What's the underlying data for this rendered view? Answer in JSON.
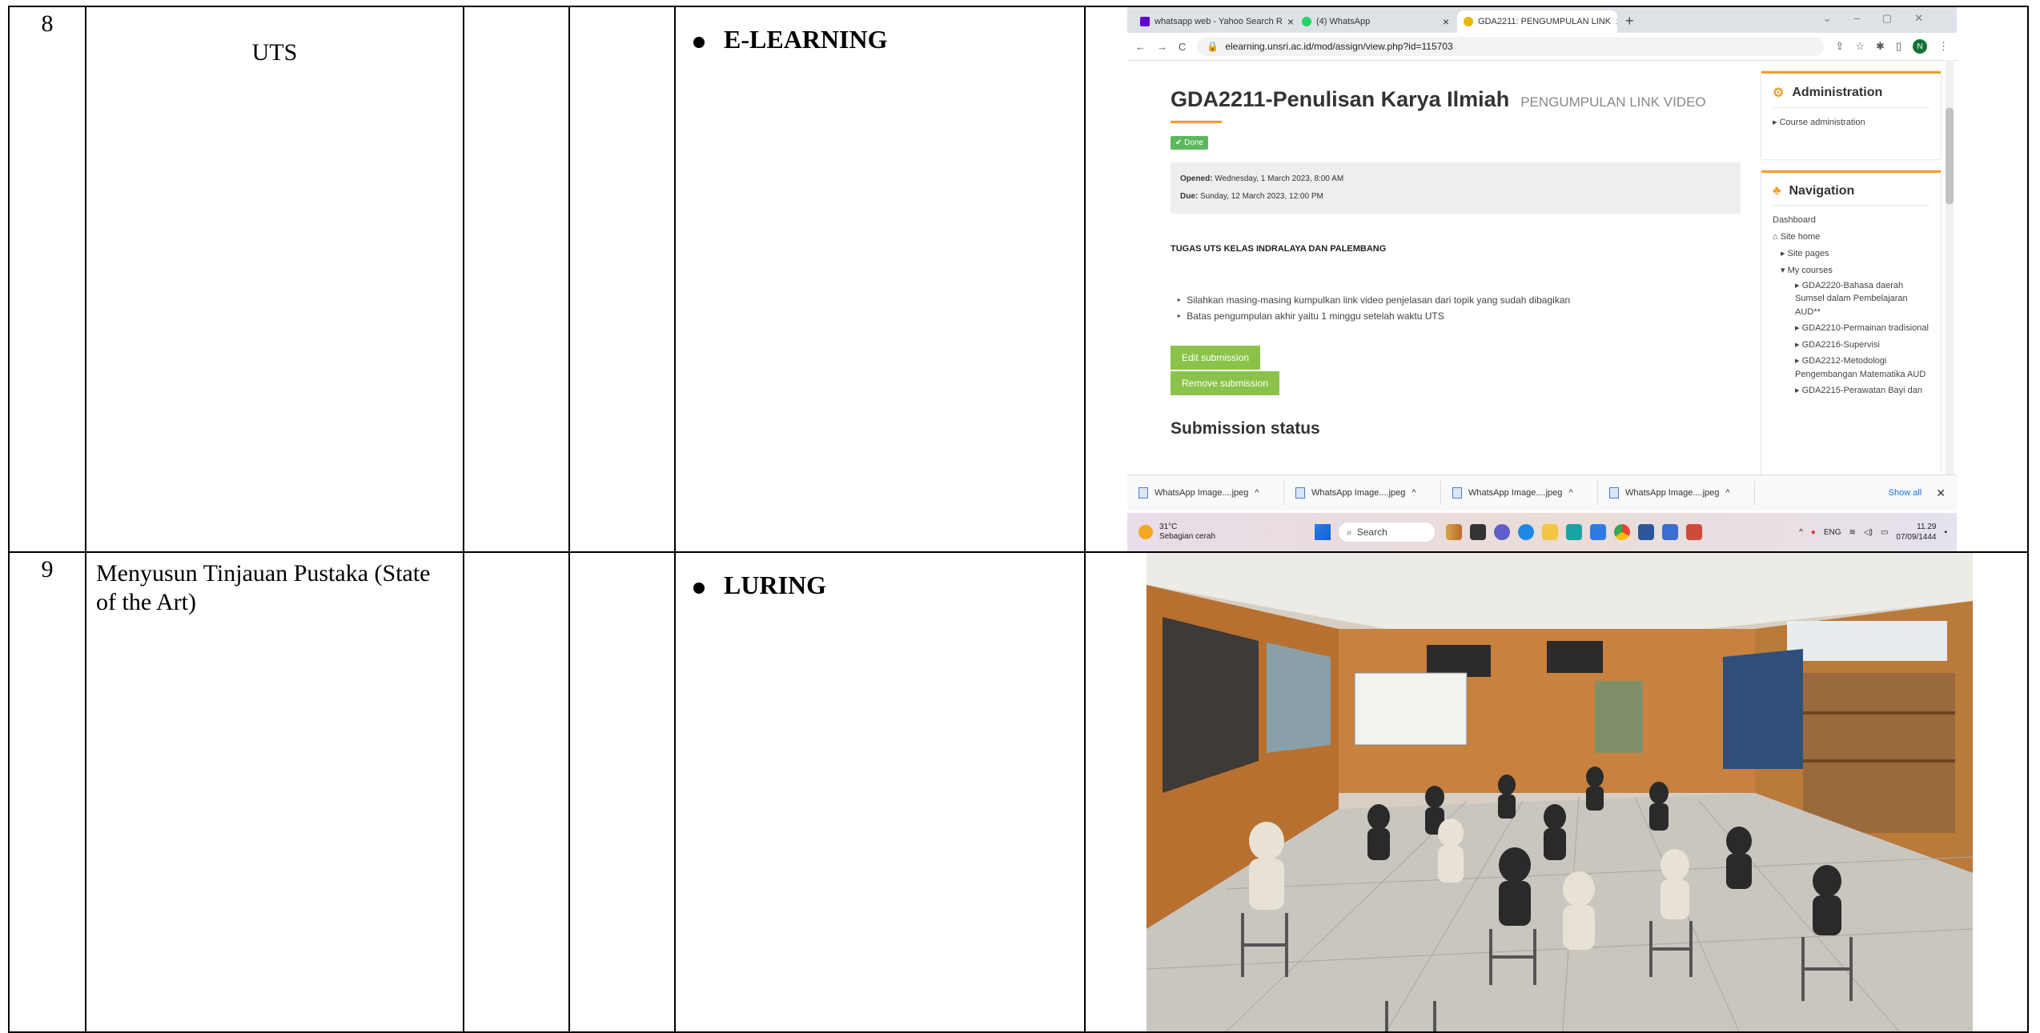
{
  "rows": [
    {
      "number": "8",
      "topic": "UTS",
      "method": "E-LEARNING",
      "evidence": {
        "browser": {
          "tabs": [
            {
              "label": "whatsapp web - Yahoo Search R",
              "color": "#6001d2"
            },
            {
              "label": "(4) WhatsApp",
              "color": "#25d366"
            },
            {
              "label": "GDA2211: PENGUMPULAN LINK",
              "color": "#e6b800"
            }
          ],
          "url": "elearning.unsri.ac.id/mod/assign/view.php?id=115703",
          "avatar_letter": "N"
        },
        "course": {
          "title": "GDA2211-Penulisan Karya Ilmiah",
          "subtitle": "PENGUMPULAN LINK VIDEO",
          "done_badge": "✔ Done",
          "opened_label": "Opened:",
          "opened_value": "Wednesday, 1 March 2023, 8:00 AM",
          "due_label": "Due:",
          "due_value": "Sunday, 12 March 2023, 12:00 PM",
          "task_heading": "TUGAS UTS KELAS INDRALAYA DAN PALEMBANG",
          "items": [
            "Silahkan masing-masing kumpulkan link video penjelasan dari topik yang sudah dibagikan",
            "Batas pengumpulan akhir yaitu 1 minggu setelah waktu UTS"
          ],
          "edit_button": "Edit submission",
          "remove_button": "Remove submission",
          "submission_heading": "Submission status"
        },
        "sidebar": {
          "admin_title": "Administration",
          "admin_item": "Course administration",
          "nav_title": "Navigation",
          "nav_dashboard": "Dashboard",
          "nav_site_home": "Site home",
          "nav_site_pages": "Site pages",
          "nav_my_courses": "My courses",
          "courses": [
            "GDA2220-Bahasa daerah Sumsel dalam Pembelajaran AUD**",
            "GDA2210-Permainan tradisional",
            "GDA2216-Supervisi",
            "GDA2212-Metodologi Pengembangan Matematika AUD",
            "GDA2215-Perawatan Bayi dan"
          ]
        },
        "downloads": {
          "files": [
            "WhatsApp Image....jpeg",
            "WhatsApp Image....jpeg",
            "WhatsApp Image....jpeg",
            "WhatsApp Image....jpeg"
          ],
          "show_all": "Show all"
        },
        "taskbar": {
          "temperature": "31°C",
          "weather": "Sebagian cerah",
          "search": "Search",
          "language": "ENG",
          "time": "11.29",
          "date": "07/09/1444"
        }
      }
    },
    {
      "number": "9",
      "topic": "Menyusun Tinjauan Pustaka (State of the Art)",
      "method": "LURING"
    }
  ]
}
